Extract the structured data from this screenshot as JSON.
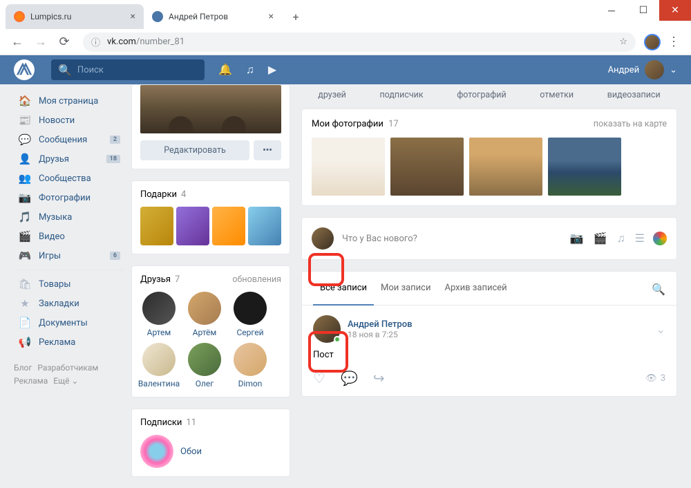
{
  "browser": {
    "tabs": [
      {
        "title": "Lumpics.ru",
        "active": false
      },
      {
        "title": "Андрей Петров",
        "active": true
      }
    ],
    "url_host": "vk.com",
    "url_path": "/number_81"
  },
  "vk_header": {
    "search_placeholder": "Поиск",
    "user_name": "Андрей"
  },
  "sidebar": {
    "items": [
      {
        "icon": "🏠",
        "label": "Моя страница"
      },
      {
        "icon": "📰",
        "label": "Новости"
      },
      {
        "icon": "💬",
        "label": "Сообщения",
        "badge": "2"
      },
      {
        "icon": "👤",
        "label": "Друзья",
        "badge": "18"
      },
      {
        "icon": "👥",
        "label": "Сообщества"
      },
      {
        "icon": "📷",
        "label": "Фотографии"
      },
      {
        "icon": "🎵",
        "label": "Музыка"
      },
      {
        "icon": "🎬",
        "label": "Видео"
      },
      {
        "icon": "🎮",
        "label": "Игры",
        "badge": "6"
      },
      {
        "icon": "🛍",
        "label": "Товары"
      },
      {
        "icon": "★",
        "label": "Закладки"
      },
      {
        "icon": "📄",
        "label": "Документы"
      },
      {
        "icon": "📢",
        "label": "Реклама"
      }
    ],
    "footer": {
      "blog": "Блог",
      "dev": "Разработчикам",
      "ads": "Реклама",
      "more": "Ещё ⌄"
    }
  },
  "profile": {
    "edit_label": "Редактировать",
    "gifts_title": "Подарки",
    "gifts_count": "4",
    "friends_title": "Друзья",
    "friends_count": "7",
    "friends_updates": "обновления",
    "friends": [
      "Артем",
      "Артём",
      "Сергей",
      "Валентина",
      "Олег",
      "Dimon"
    ],
    "subs_title": "Подписки",
    "subs_count": "11",
    "sub_name": "Обои"
  },
  "stats": {
    "friends": "друзей",
    "subs": "подписчик",
    "photos": "фотографий",
    "tags": "отметки",
    "videos": "видеозаписи"
  },
  "photos": {
    "title": "Мои фотографии",
    "count": "17",
    "map_link": "показать на карте"
  },
  "composer": {
    "placeholder": "Что у Вас нового?"
  },
  "wall_tabs": {
    "all": "Все записи",
    "mine": "Мои записи",
    "archive": "Архив записей"
  },
  "post": {
    "author": "Андрей Петров",
    "time": "18 ноя в 7:25",
    "text": "Пост",
    "views": "3"
  }
}
